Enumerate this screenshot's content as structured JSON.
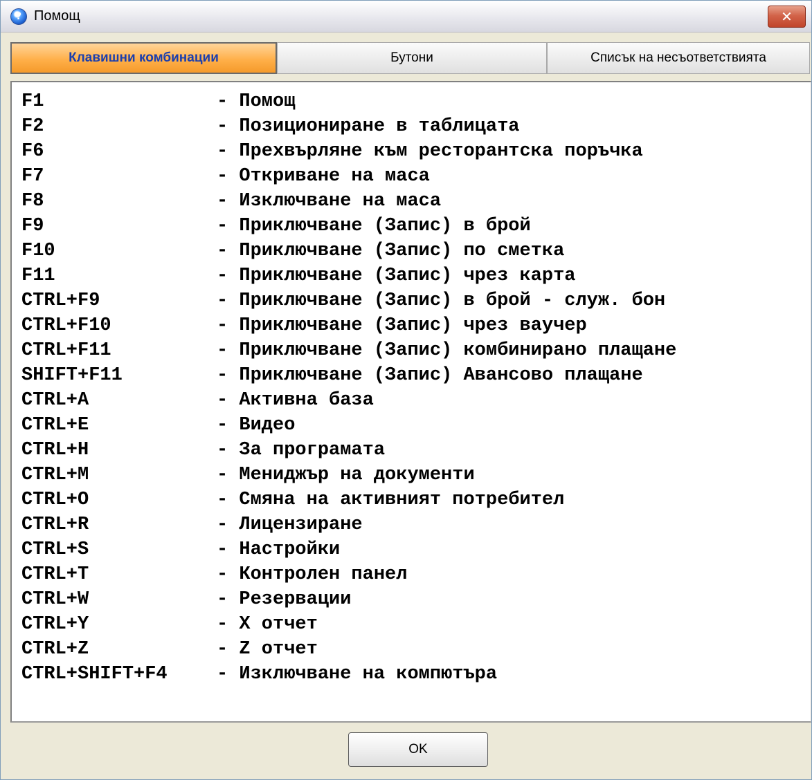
{
  "window": {
    "title": "Помощ",
    "close_label": "✕"
  },
  "tabs": [
    {
      "label": "Клавишни комбинации",
      "active": true
    },
    {
      "label": "Бутони",
      "active": false
    },
    {
      "label": "Списък на несъответствията",
      "active": false
    }
  ],
  "shortcuts": [
    {
      "key": "F1",
      "desc": "- Помощ"
    },
    {
      "key": "F2",
      "desc": "- Позициониране в таблицата"
    },
    {
      "key": "F6",
      "desc": "- Прехвърляне към ресторантска поръчка"
    },
    {
      "key": "F7",
      "desc": "- Откриване на маса"
    },
    {
      "key": "F8",
      "desc": "- Изключване на маса"
    },
    {
      "key": "F9",
      "desc": "- Приключване (Запис) в брой"
    },
    {
      "key": "F10",
      "desc": "- Приключване (Запис) по сметка"
    },
    {
      "key": "F11",
      "desc": "- Приключване (Запис) чрез карта"
    },
    {
      "key": "CTRL+F9",
      "desc": "- Приключване (Запис) в брой - служ. бон"
    },
    {
      "key": "CTRL+F10",
      "desc": "- Приключване (Запис) чрез ваучер"
    },
    {
      "key": "CTRL+F11",
      "desc": "- Приключване (Запис) комбинирано плащане"
    },
    {
      "key": "SHIFT+F11",
      "desc": "- Приключване (Запис) Авансово плащане"
    },
    {
      "key": "CTRL+A",
      "desc": "- Активна база"
    },
    {
      "key": "CTRL+E",
      "desc": "- Видео"
    },
    {
      "key": "CTRL+H",
      "desc": "- За програмата"
    },
    {
      "key": "CTRL+M",
      "desc": "- Мениджър на документи"
    },
    {
      "key": "CTRL+O",
      "desc": "- Смяна на активният потребител"
    },
    {
      "key": "CTRL+R",
      "desc": "- Лицензиране"
    },
    {
      "key": "CTRL+S",
      "desc": "- Настройки"
    },
    {
      "key": "CTRL+T",
      "desc": "- Контролен панел"
    },
    {
      "key": "CTRL+W",
      "desc": "- Резервации"
    },
    {
      "key": "CTRL+Y",
      "desc": "- X отчет"
    },
    {
      "key": "CTRL+Z",
      "desc": "- Z отчет"
    },
    {
      "key": "CTRL+SHIFT+F4",
      "desc": "- Изключване на компютъра"
    }
  ],
  "ok_button": {
    "label": "OK"
  }
}
